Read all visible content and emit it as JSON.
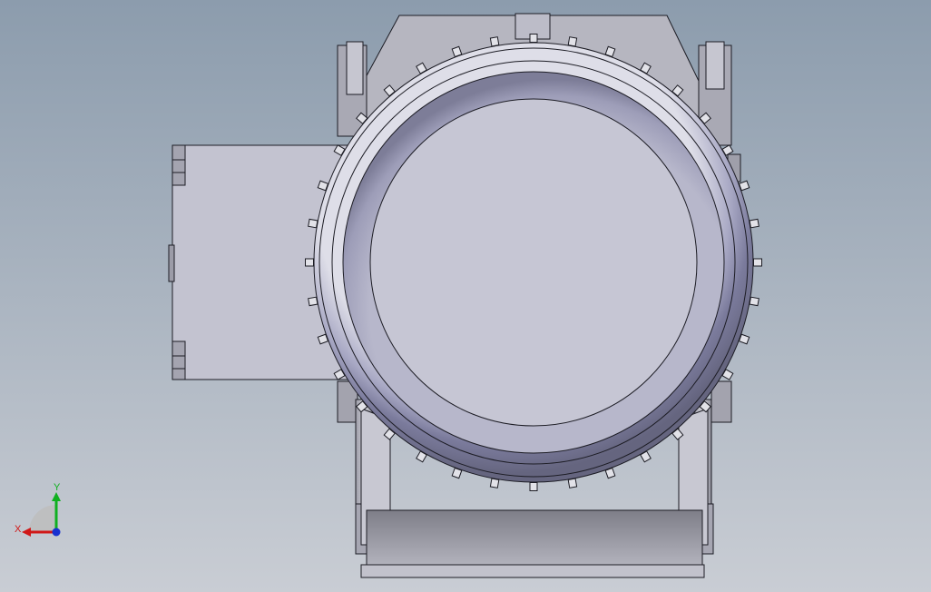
{
  "viewport": {
    "background_top": "#8c9cad",
    "background_bottom": "#c9cdd4"
  },
  "model": {
    "body_color": "#c3c3d0",
    "edge_color": "#1c1c24",
    "bolt_count": 36
  },
  "triad": {
    "x_label": "X",
    "y_label": "Y",
    "x_color": "#d01818",
    "y_color": "#10b020",
    "z_color": "#1830d0"
  }
}
